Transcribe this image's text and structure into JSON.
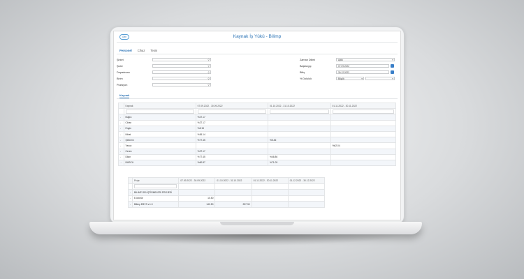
{
  "app": {
    "title": "Kaynak İş Yükü - Bilimp",
    "back_label": "Geri"
  },
  "tabs": [
    {
      "label": "Personel"
    },
    {
      "label": "Cihaz"
    },
    {
      "label": "Tesis"
    }
  ],
  "filters_left": [
    {
      "label": "Şirket"
    },
    {
      "label": "Şube"
    },
    {
      "label": "Departman"
    },
    {
      "label": "Birim"
    },
    {
      "label": "Pozisyon"
    }
  ],
  "filters_right": {
    "period_label": "Zaman Dilimi",
    "period_value": "Aylık",
    "start_label": "Başlangıç",
    "start_value": "07.09.2022",
    "end_label": "Bitiş",
    "end_value": "30.12.2022",
    "fill_label": "% Doluluk",
    "fill_value": "Büyük"
  },
  "subtab": "Kaynak",
  "resource_table": {
    "headers": [
      "Kaynak",
      "07.09.2022 - 30.09.2022",
      "01.10.2022 - 31.10.2022",
      "01.11.2022 - 30.11.2022"
    ],
    "rows": [
      {
        "name": "Buğra",
        "c1": "%27.17",
        "c2": "",
        "c3": ""
      },
      {
        "name": "Cihan",
        "c1": "%27.17",
        "c2": "",
        "c3": ""
      },
      {
        "name": "Engin",
        "c1": "%8.15",
        "c2": "",
        "c3": ""
      },
      {
        "name": "Nihat",
        "c1": "%36.14",
        "c2": "",
        "c3": ""
      },
      {
        "name": "Şebnem",
        "c1": "%77.45",
        "c2": "%5.46",
        "c3": ""
      },
      {
        "name": "Yavuz",
        "c1": "",
        "c2": "",
        "c3": "%62.04"
      },
      {
        "name": "Ceren",
        "c1": "%27.17",
        "c2": "",
        "c3": ""
      },
      {
        "name": "Dilan",
        "c1": "%77.45",
        "c2": "%46.86",
        "c3": ""
      },
      {
        "name": "BURCU",
        "c1": "%60.87",
        "c2": "%71.09",
        "c3": ""
      }
    ]
  },
  "project_table": {
    "headers": [
      "Proje",
      "07.09.2022 - 30.09.2022",
      "01.10.2022 - 31.10.2022",
      "01.11.2022 - 30.11.2022",
      "01.12.2022 - 30.12.2022"
    ],
    "rows": [
      {
        "name": "BİLİMP GELİŞTİRMELERİ PROJESİ",
        "c1": "",
        "c2": "",
        "c3": "",
        "c4": ""
      },
      {
        "name": "E-Mühür",
        "c1": "10.50",
        "c2": "",
        "c3": "",
        "c4": ""
      },
      {
        "name": "Bilimp EBYS v.1.0",
        "c1": "142.50",
        "c2": "257.30",
        "c3": "",
        "c4": ""
      }
    ]
  }
}
